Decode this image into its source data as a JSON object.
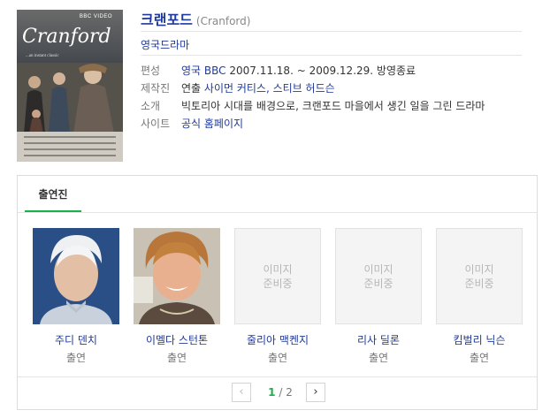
{
  "poster": {
    "label": "BBC VIDEO",
    "title": "Cranford",
    "tagline": "...an instant classic"
  },
  "header": {
    "title": "크랜포드",
    "title_en": "(Cranford)",
    "genre": "영국드라마"
  },
  "info": {
    "broadcast_label": "편성",
    "broadcast_link": "영국 BBC",
    "broadcast_period": "2007.11.18. ~ 2009.12.29. 방영종료",
    "production_label": "제작진",
    "production_role": "연출",
    "production_names": "사이먼 커티스, 스티브 허드슨",
    "synopsis_label": "소개",
    "synopsis": "빅토리아 시대를 배경으로, 크랜포드 마을에서 생긴 일을 그린 드라마",
    "site_label": "사이트",
    "site_link": "공식 홈페이지"
  },
  "cast": {
    "tab_label": "출연진",
    "members": [
      {
        "name": "주디 덴치",
        "role": "출연",
        "has_photo": true
      },
      {
        "name": "이멜다 스턴톤",
        "role": "출연",
        "has_photo": true
      },
      {
        "name": "줄리아 맥켄지",
        "role": "출연",
        "has_photo": false
      },
      {
        "name": "리사 딜론",
        "role": "출연",
        "has_photo": false
      },
      {
        "name": "킴벌리 닉슨",
        "role": "출연",
        "has_photo": false
      }
    ],
    "placeholder_line1": "이미지",
    "placeholder_line2": "준비중"
  },
  "pager": {
    "current": "1",
    "separator": "/",
    "total": "2",
    "prev_icon": "chevron-left-icon",
    "next_icon": "chevron-right-icon"
  },
  "colors": {
    "link": "#1f3a9a",
    "accent": "#19b14b",
    "border": "#dcdcdc"
  }
}
